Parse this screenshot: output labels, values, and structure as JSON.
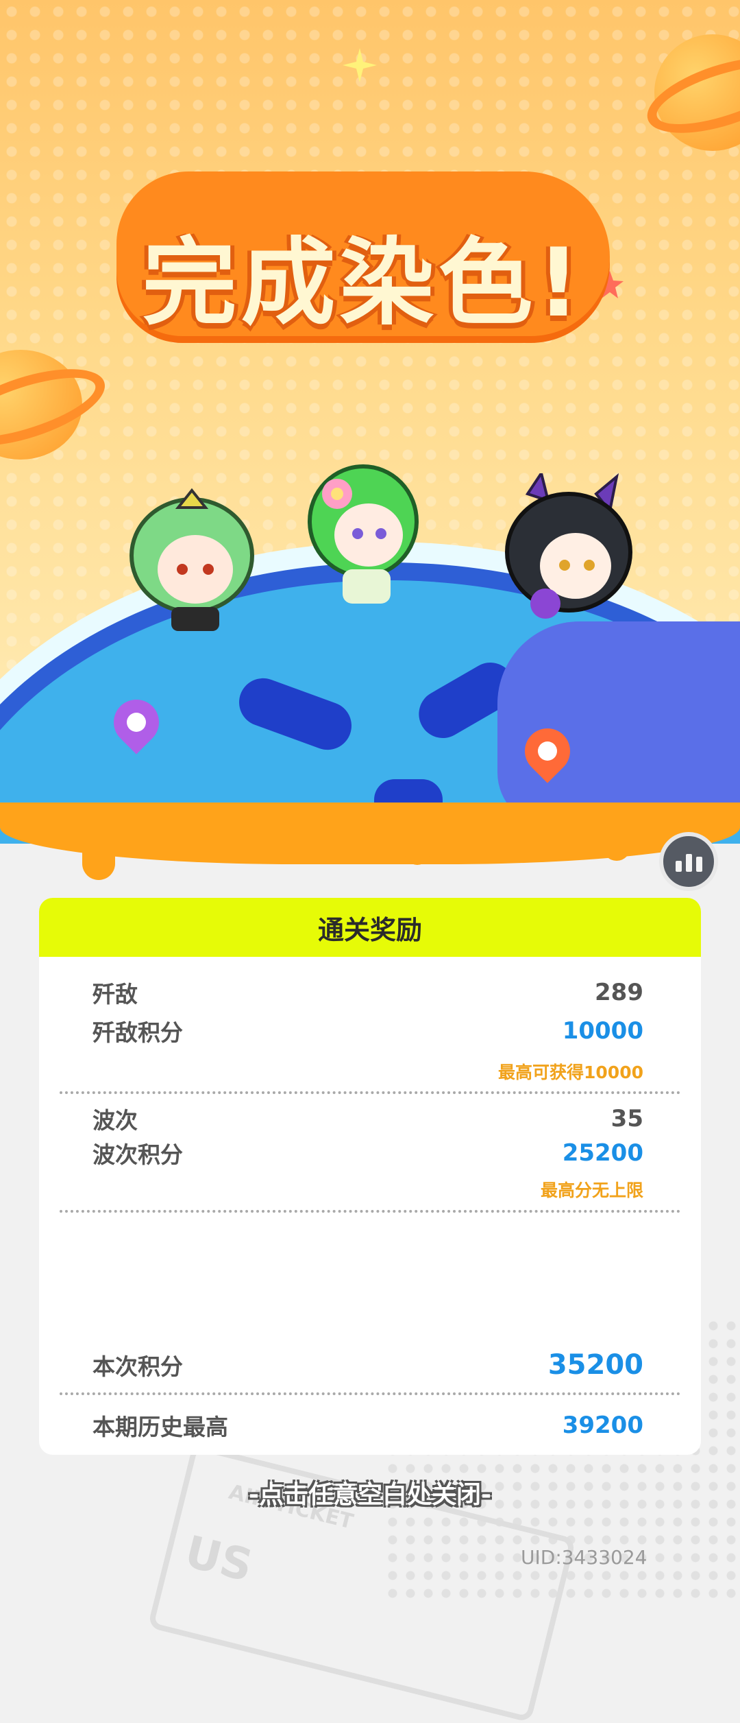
{
  "title": "完成染色!",
  "card": {
    "header": "通关奖励",
    "kills_label": "歼敌",
    "kills_value": "289",
    "kill_score_label": "歼敌积分",
    "kill_score_value": "10000",
    "kill_score_note": "最高可获得10000",
    "waves_label": "波次",
    "waves_value": "35",
    "wave_score_label": "波次积分",
    "wave_score_value": "25200",
    "wave_score_note": "最高分无上限",
    "total_label": "本次积分",
    "total_value": "35200",
    "best_label": "本期历史最高",
    "best_value": "39200"
  },
  "close_hint": "-点击任意空白处关闭-",
  "uid": "UID:3433024",
  "ticket_text": "AIR TICKET",
  "ticket_code": "US",
  "colors": {
    "header_bg": "#e6fb07",
    "score_blue": "#1a8fe6",
    "note_orange": "#f1a21b",
    "slime_orange": "#ffa31a",
    "globe_blue": "#3fb1ec"
  }
}
